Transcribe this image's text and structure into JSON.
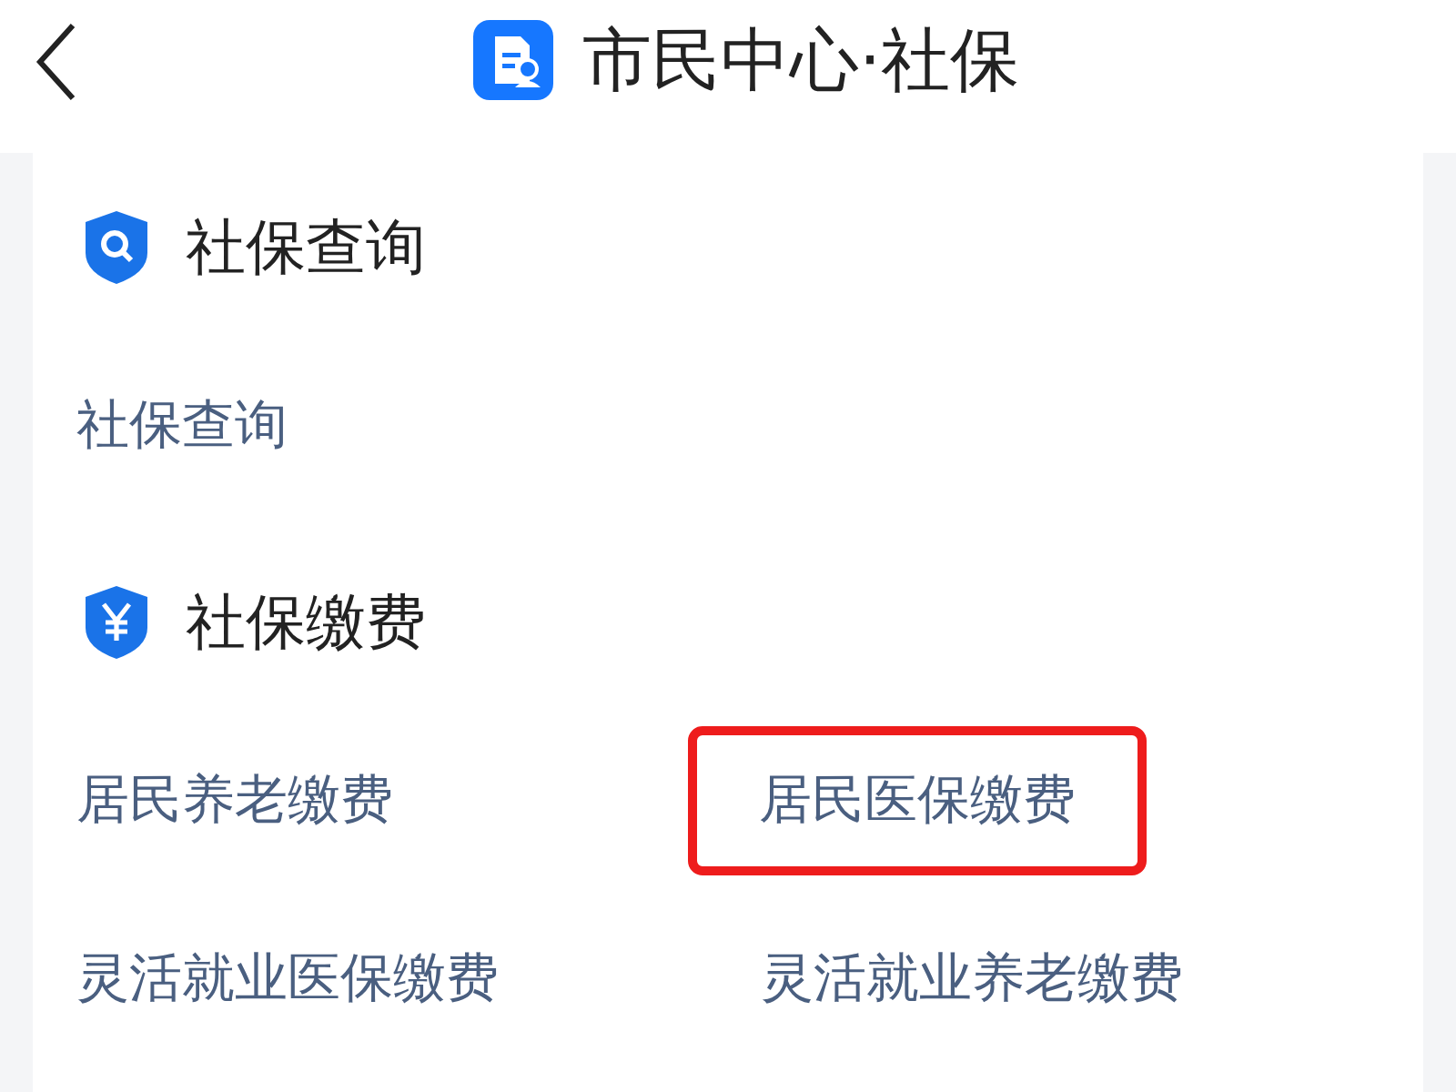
{
  "header": {
    "title": "市民中心·社保"
  },
  "sections": [
    {
      "title": "社保查询",
      "kind": "search",
      "items": [
        {
          "label": "社保查询",
          "highlighted": false
        }
      ]
    },
    {
      "title": "社保缴费",
      "kind": "payment",
      "items": [
        {
          "label": "居民养老缴费",
          "highlighted": false
        },
        {
          "label": "居民医保缴费",
          "highlighted": true
        },
        {
          "label": "灵活就业医保缴费",
          "highlighted": false
        },
        {
          "label": "灵活就业养老缴费",
          "highlighted": false
        }
      ]
    }
  ]
}
